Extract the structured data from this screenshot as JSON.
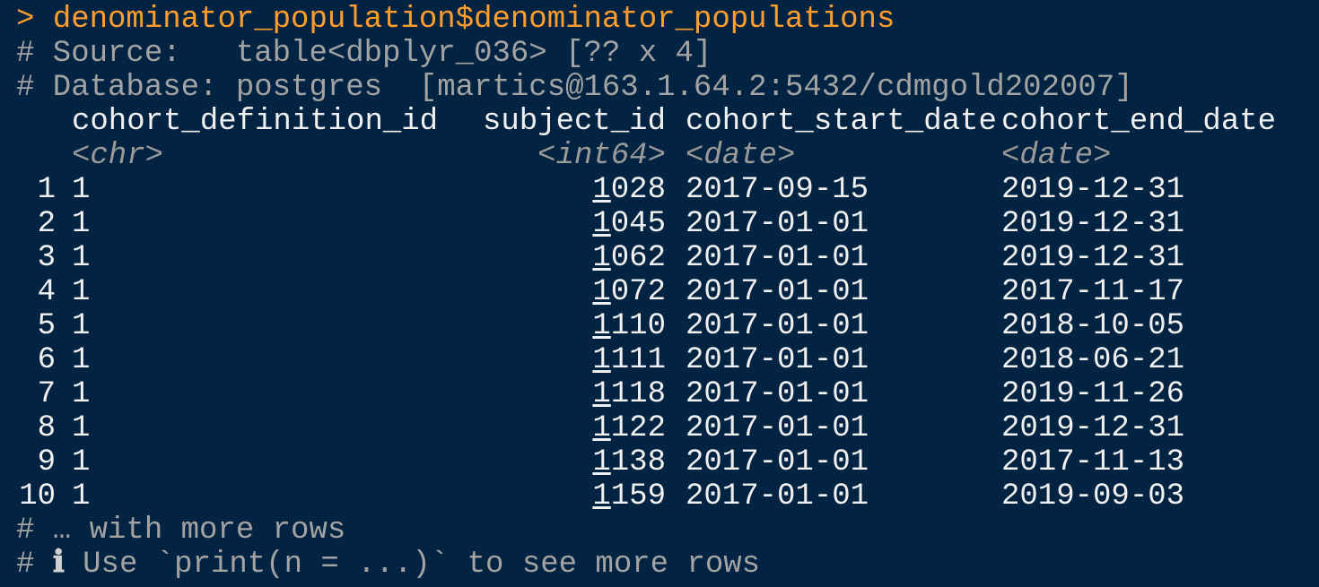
{
  "console": {
    "prompt_symbol": ">",
    "command": "denominator_population$denominator_populations",
    "source_line": "# Source:   table<dbplyr_036> [?? x 4]",
    "database_line": "# Database: postgres  [martics@163.1.64.2:5432/cdmgold202007]",
    "columns": [
      {
        "name": "cohort_definition_id",
        "type": "<chr>"
      },
      {
        "name": "subject_id",
        "type": "<int64>"
      },
      {
        "name": "cohort_start_date",
        "type": "<date>"
      },
      {
        "name": "cohort_end_date",
        "type": "<date>"
      }
    ],
    "rows": [
      {
        "n": "1",
        "def": "1",
        "sub_first": "1",
        "sub_rest": "028",
        "start": "2017-09-15",
        "end": "2019-12-31"
      },
      {
        "n": "2",
        "def": "1",
        "sub_first": "1",
        "sub_rest": "045",
        "start": "2017-01-01",
        "end": "2019-12-31"
      },
      {
        "n": "3",
        "def": "1",
        "sub_first": "1",
        "sub_rest": "062",
        "start": "2017-01-01",
        "end": "2019-12-31"
      },
      {
        "n": "4",
        "def": "1",
        "sub_first": "1",
        "sub_rest": "072",
        "start": "2017-01-01",
        "end": "2017-11-17"
      },
      {
        "n": "5",
        "def": "1",
        "sub_first": "1",
        "sub_rest": "110",
        "start": "2017-01-01",
        "end": "2018-10-05"
      },
      {
        "n": "6",
        "def": "1",
        "sub_first": "1",
        "sub_rest": "111",
        "start": "2017-01-01",
        "end": "2018-06-21"
      },
      {
        "n": "7",
        "def": "1",
        "sub_first": "1",
        "sub_rest": "118",
        "start": "2017-01-01",
        "end": "2019-11-26"
      },
      {
        "n": "8",
        "def": "1",
        "sub_first": "1",
        "sub_rest": "122",
        "start": "2017-01-01",
        "end": "2019-12-31"
      },
      {
        "n": "9",
        "def": "1",
        "sub_first": "1",
        "sub_rest": "138",
        "start": "2017-01-01",
        "end": "2017-11-13"
      },
      {
        "n": "10",
        "def": "1",
        "sub_first": "1",
        "sub_rest": "159",
        "start": "2017-01-01",
        "end": "2019-09-03"
      }
    ],
    "footer_more": "# … with more rows",
    "footer_hint_prefix": "# ",
    "footer_hint_icon": "ℹ",
    "footer_hint_text": " Use `print(n = ...)` to see more rows"
  },
  "colors": {
    "background": "#022341",
    "prompt": "#ff9d2e",
    "text": "#f0f0f0",
    "comment": "#a3a3a3"
  }
}
